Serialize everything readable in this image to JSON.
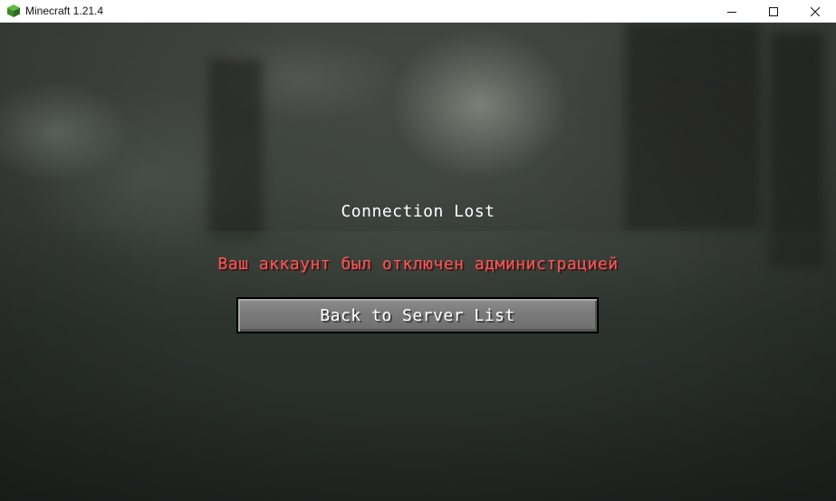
{
  "window": {
    "title": "Minecraft 1.21.4",
    "app_icon": "grass-block-icon",
    "controls": {
      "minimize": "minimize-icon",
      "maximize": "maximize-icon",
      "close": "close-icon"
    }
  },
  "screen": {
    "heading": "Connection Lost",
    "reason": "Ваш аккаунт был отключен администрацией",
    "reason_color": "#ff5555",
    "back_button_label": "Back to Server List"
  }
}
